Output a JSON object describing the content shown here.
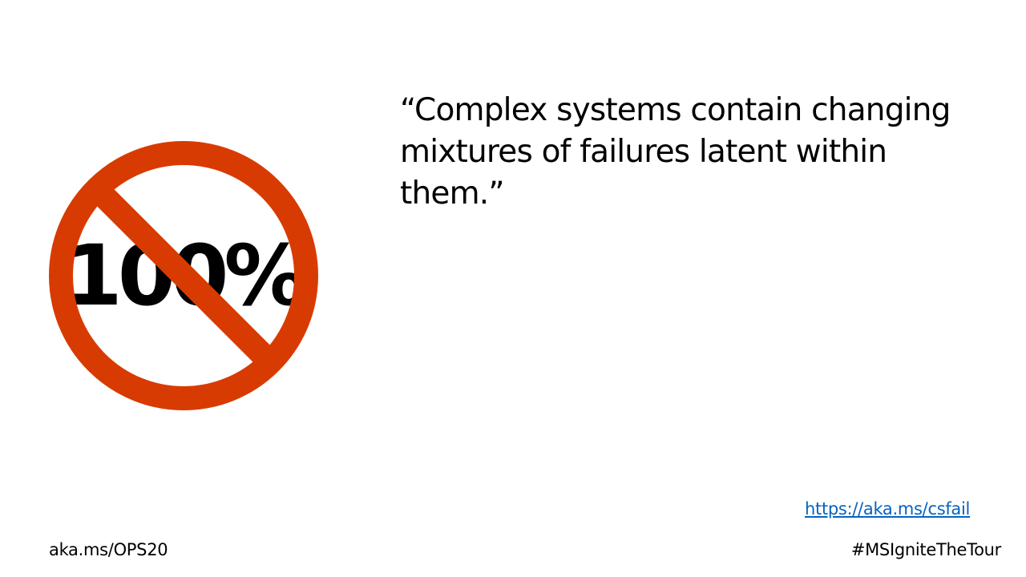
{
  "sign": {
    "text": "100%",
    "icon": "prohibition-sign-icon",
    "ring_color": "#d83b01",
    "text_color": "#000000"
  },
  "quote": {
    "text": "“Complex systems contain changing mixtures of failures latent within them.”"
  },
  "source_link": {
    "text": "https://aka.ms/csfail",
    "color": "#0563c1"
  },
  "footer": {
    "left_text": "aka.ms/OPS20",
    "right_text": "#MSIgniteTheTour"
  }
}
